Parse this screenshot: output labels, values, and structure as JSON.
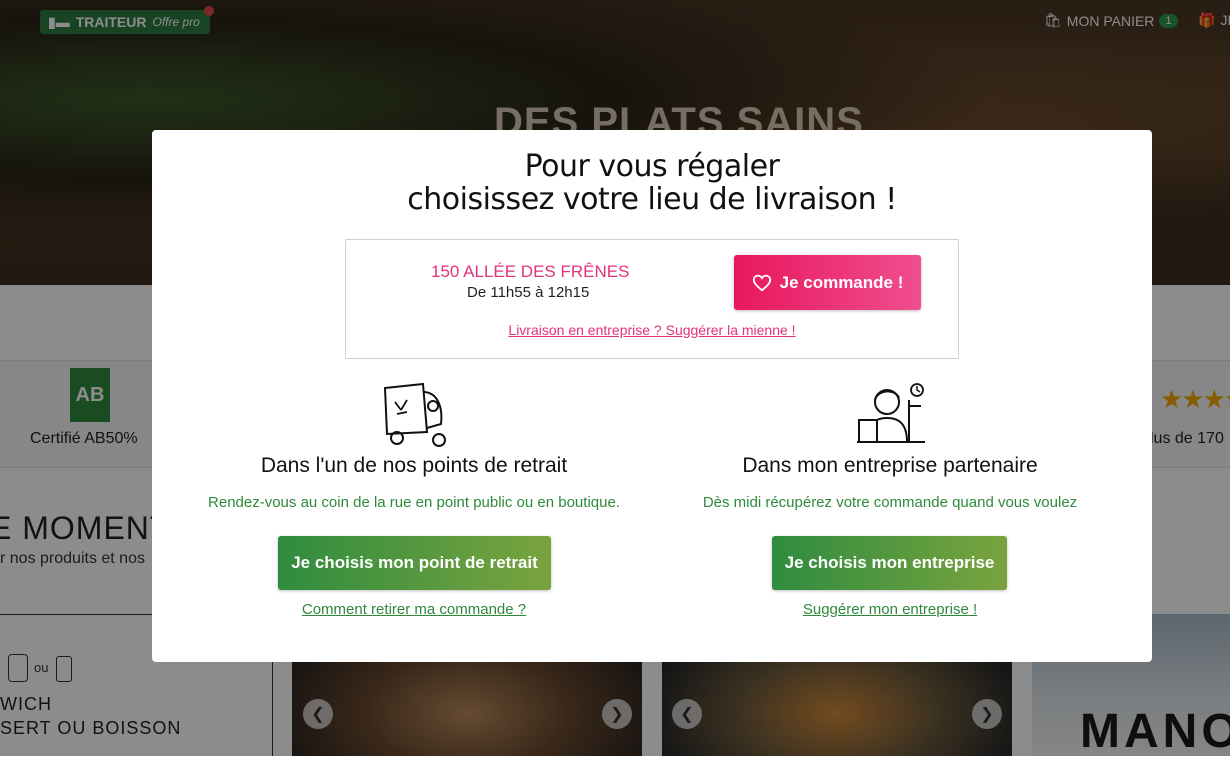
{
  "background": {
    "logo": {
      "brand": "TRAITEUR",
      "suffix": "Offre pro"
    },
    "cart": {
      "label": "MON PANIER",
      "count": "1"
    },
    "gift_label": "JE",
    "hero_title": "DES PLATS SAINS",
    "certification": "Certifié AB50%",
    "reviews": "lus de 170",
    "section_title": "E MOMENT",
    "section_subtitle": "r nos produits et nos",
    "menu_or": "ou",
    "menu_line1": "WICH",
    "menu_line2": "SERT OU BOISSON",
    "card3_text": "MANO"
  },
  "modal": {
    "title_line1": "Pour vous régaler",
    "title_line2": "choisissez votre lieu de livraison !",
    "address": {
      "name": "150 ALLÉE DES FRÊNES",
      "hours": "De 11h55 à 12h15",
      "order_button": "Je commande !",
      "suggest_link": "Livraison en entreprise ? Suggérer la mienne !"
    },
    "pickup": {
      "title": "Dans l'un de nos points de retrait",
      "description": "Rendez-vous au coin de la rue en point public ou en boutique.",
      "button": "Je choisis mon point de retrait",
      "link": "Comment retirer ma commande ?"
    },
    "company": {
      "title": "Dans mon entreprise partenaire",
      "description": "Dès midi récupérez votre commande quand vous voulez",
      "button": "Je choisis mon entreprise",
      "link": "Suggérer mon entreprise !"
    }
  },
  "colors": {
    "pink": "#e8175d",
    "green": "#2f8c3f",
    "green_end": "#7aa33f"
  }
}
